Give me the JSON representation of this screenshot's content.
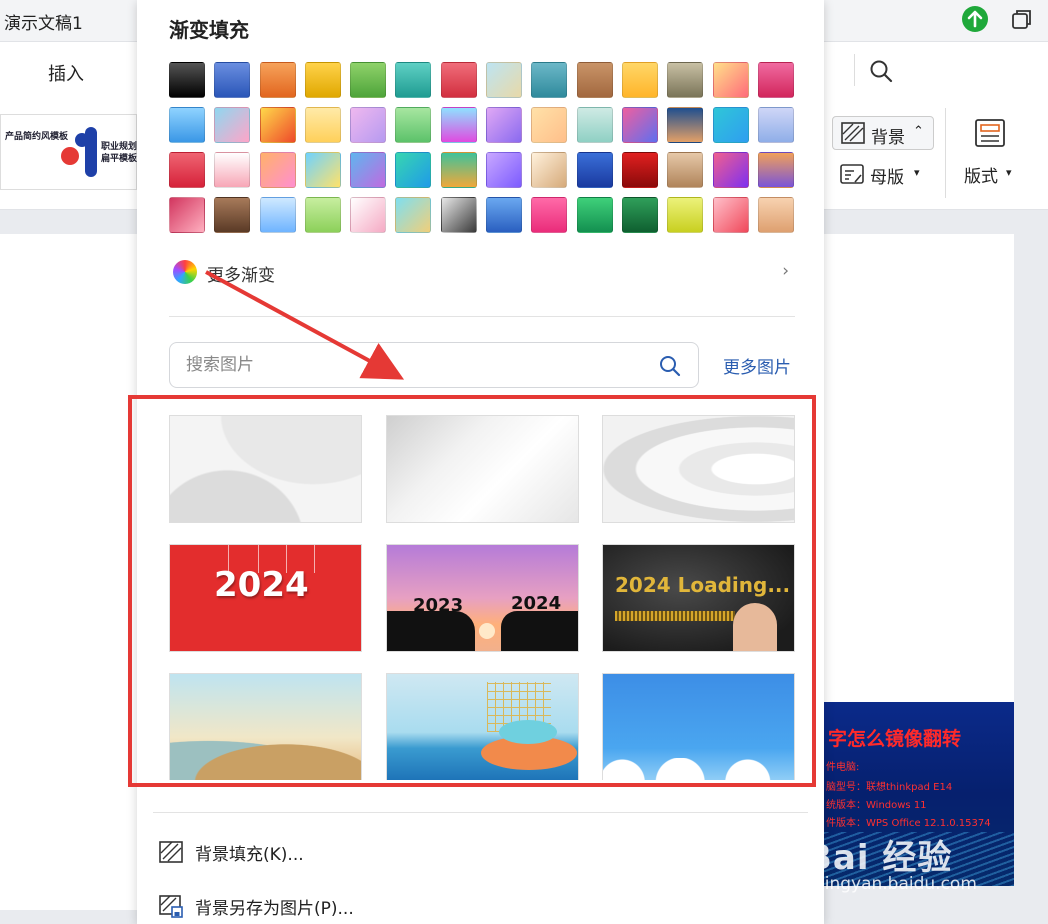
{
  "window": {
    "title": "演示文稿1"
  },
  "menu": {
    "insert": "插入"
  },
  "thumb": {
    "a": "产品简约风模板",
    "b": "职业规划\n扁平模板"
  },
  "ribbon": {
    "background": "背景",
    "master": "母版",
    "layout": "版式"
  },
  "slide": {
    "title": "字怎么镜像翻转",
    "line1": "件电脑:",
    "line2": "脑型号：联想thinkpad E14",
    "line3": "统版本：Windows 11",
    "line4": "件版本：WPS Office 12.1.0.15374"
  },
  "watermark": {
    "brand": "Bai 经验",
    "url": "jingyan.baidu.com"
  },
  "panel": {
    "title": "渐变填充",
    "more_gradient": "更多渐变",
    "search_placeholder": "搜索图片",
    "more_images": "更多图片",
    "images": [
      {
        "text": ""
      },
      {
        "text": ""
      },
      {
        "text": ""
      },
      {
        "text": "2024"
      },
      {
        "text": "2023 · 2024",
        "y1": "2023",
        "y2": "2024"
      },
      {
        "text": "2024 Loading..."
      },
      {
        "text": ""
      },
      {
        "text": ""
      },
      {
        "text": ""
      }
    ],
    "menu_items": [
      {
        "label": "背景填充(K)..."
      },
      {
        "label": "背景另存为图片(P)..."
      }
    ]
  },
  "gradients": [
    "linear-gradient(180deg,#555,#000)",
    "linear-gradient(180deg,#6a8ee0,#2a56b8)",
    "linear-gradient(180deg,#f6a25a,#e2661f)",
    "linear-gradient(180deg,#ffd24a,#e0a800)",
    "linear-gradient(180deg,#8fd26a,#4ea43a)",
    "linear-gradient(180deg,#5fd0c4,#1f9c92)",
    "linear-gradient(180deg,#f06d7a,#d22f3f)",
    "linear-gradient(135deg,#bde4f2,#e8d9a8)",
    "linear-gradient(180deg,#6cb8c8,#2f8a9c)",
    "linear-gradient(180deg,#c99468,#a2683f)",
    "linear-gradient(180deg,#ffd767,#ffb52a)",
    "linear-gradient(180deg,#c8c0a4,#7a7458)",
    "linear-gradient(135deg,#ffe08a,#ff6b7a)",
    "linear-gradient(180deg,#f06aa0,#d2265c)",
    "linear-gradient(180deg,#8fd3ff,#3a97e6)",
    "linear-gradient(135deg,#8fd7f0,#ffa5c8)",
    "linear-gradient(135deg,#ffd84a,#ee4a2a)",
    "linear-gradient(180deg,#ffeaa8,#ffd05a)",
    "linear-gradient(135deg,#efb8ef,#b69af0)",
    "linear-gradient(180deg,#a7e6a0,#5cc26a)",
    "linear-gradient(180deg,#8fe1ff,#e04ae0)",
    "linear-gradient(135deg,#e0a8f4,#8a6af0)",
    "linear-gradient(135deg,#ffe1a8,#ffbf8a)",
    "linear-gradient(180deg,#cfeae4,#8fd0c4)",
    "linear-gradient(135deg,#ef5f9f,#5f6fef)",
    "linear-gradient(180deg,#1f4f8f,#e3a067)",
    "linear-gradient(135deg,#2fc6d8,#2f9ef0)",
    "linear-gradient(180deg,#cfd6f7,#8faee8)",
    "linear-gradient(180deg,#ef6472,#d6223a)",
    "linear-gradient(180deg,#fff,#f7a6b6)",
    "linear-gradient(135deg,#ffb16a,#ff8fd0)",
    "linear-gradient(135deg,#6fd2ff,#ffe26a)",
    "linear-gradient(135deg,#5fb5ef,#c06ae0)",
    "linear-gradient(135deg,#37d6b0,#1f9be8)",
    "linear-gradient(180deg,#3fc29a,#f0a83a)",
    "linear-gradient(135deg,#c9a8ff,#7c5bff)",
    "linear-gradient(135deg,#fff1dc,#d6aa7a)",
    "linear-gradient(180deg,#3a6fd8,#1a3aa0)",
    "linear-gradient(180deg,#e02020,#8a0a0a)",
    "linear-gradient(180deg,#e6c8a8,#b0845a)",
    "linear-gradient(135deg,#f0608f,#7e2ff0)",
    "linear-gradient(180deg,#f0a05a,#7a54d8)",
    "linear-gradient(135deg,#d2365f,#ffb0c0)",
    "linear-gradient(180deg,#a77a5a,#5a3a26)",
    "linear-gradient(180deg,#cfe9ff,#6fb4ff)",
    "linear-gradient(180deg,#c7ee9f,#8cd05a)",
    "linear-gradient(135deg,#fff,#f5aac4)",
    "linear-gradient(135deg,#7fdff0,#f0cf7a)",
    "linear-gradient(135deg,#e8e8e8,#3a3a3a)",
    "linear-gradient(180deg,#6aa8f0,#2a5fc0)",
    "linear-gradient(180deg,#ff6aa8,#ea2c7a)",
    "linear-gradient(180deg,#3fd07a,#139050)",
    "linear-gradient(180deg,#2f9f5a,#0f5f30)",
    "linear-gradient(180deg,#ecf27a,#c8d020)",
    "linear-gradient(135deg,#ffc0ca,#f0485a)",
    "linear-gradient(180deg,#f7d2b0,#dea070)"
  ]
}
